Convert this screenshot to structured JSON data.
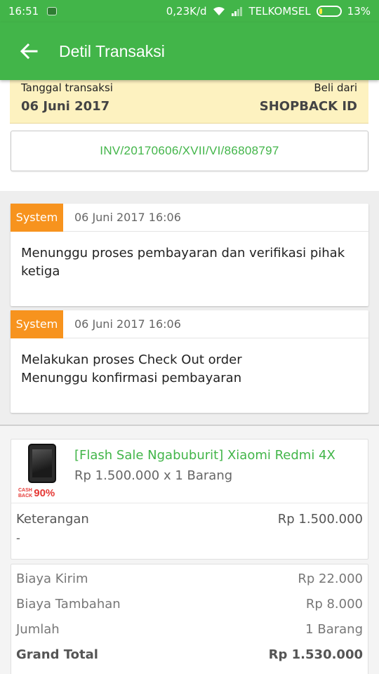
{
  "status_bar": {
    "time": "16:51",
    "speed": "0,23K/d",
    "carrier": "TELKOMSEL",
    "battery": "13%",
    "battery_level": 0.13,
    "battery_color": "#ffeb3b"
  },
  "app_bar": {
    "title": "Detil Transaksi",
    "color": "#42b549",
    "back_icon": "arrow-left-icon"
  },
  "transaction": {
    "date_label": "Tanggal transaksi",
    "date_value": "06 Juni 2017",
    "seller_label": "Beli dari",
    "seller_value": "SHOPBACK ID",
    "invoice": "INV/20170606/XVII/VI/86808797"
  },
  "history": [
    {
      "tag": "System",
      "time": "06 Juni 2017 16:06",
      "lines": [
        "Menunggu proses pembayaran dan verifikasi pihak",
        "ketiga"
      ]
    },
    {
      "tag": "System",
      "time": "06 Juni 2017 16:06",
      "lines": [
        "Melakukan proses Check Out order",
        "Menunggu konfirmasi pembayaran"
      ]
    }
  ],
  "product": {
    "name": "[Flash Sale Ngabuburit] Xiaomi Redmi 4X",
    "price_qty": "Rp 1.500.000 x 1 Barang",
    "badge_small_1": "CASH",
    "badge_small_2": "BACK",
    "badge_pct": "90%",
    "note_label": "Keterangan",
    "note_value": "Rp 1.500.000",
    "note_text": "-"
  },
  "summary": {
    "rows": [
      {
        "label": "Biaya Kirim",
        "value": "Rp 22.000"
      },
      {
        "label": "Biaya Tambahan",
        "value": "Rp 8.000"
      },
      {
        "label": "Jumlah",
        "value": "1 Barang"
      }
    ],
    "total_label": "Grand Total",
    "total_value": "Rp 1.530.000"
  },
  "colors": {
    "accent_green": "#42b549",
    "system_tag": "#f7931e",
    "date_card_bg": "#fdf2c0"
  }
}
